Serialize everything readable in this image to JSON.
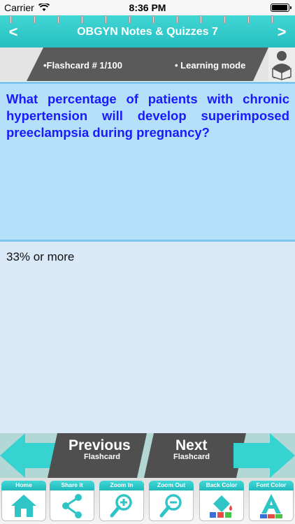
{
  "status_bar": {
    "carrier": "Carrier",
    "time": "8:36 PM",
    "battery_level": 1.0
  },
  "header": {
    "title": "OBGYN Notes & Quizzes 7",
    "back_icon": "chevron-left-icon",
    "forward_icon": "chevron-right-icon",
    "accent_color": "#2ec8c8"
  },
  "info": {
    "flashcard_counter": "•Flashcard #  1/100",
    "mode": "• Learning mode",
    "mode_icon": "reader-icon"
  },
  "card": {
    "question": "What percentage of patients with chronic hypertension will develop superimposed preeclampsia during pregnancy?",
    "answer": "33% or more",
    "question_color": "#1a1aff",
    "question_bg": "#b5e0fa",
    "answer_bg": "#d9e9f7"
  },
  "navigation": {
    "previous": {
      "title": "Previous",
      "subtitle": "Flashcard"
    },
    "next": {
      "title": "Next",
      "subtitle": "Flashcard"
    }
  },
  "toolbar": {
    "items": [
      {
        "label": "Home",
        "icon": "home-icon"
      },
      {
        "label": "Share it",
        "icon": "share-icon"
      },
      {
        "label": "Zoom In",
        "icon": "zoom-in-icon"
      },
      {
        "label": "Zoom Out",
        "icon": "zoom-out-icon"
      },
      {
        "label": "Back Color",
        "icon": "back-color-icon"
      },
      {
        "label": "Font Color",
        "icon": "font-color-icon"
      }
    ]
  }
}
